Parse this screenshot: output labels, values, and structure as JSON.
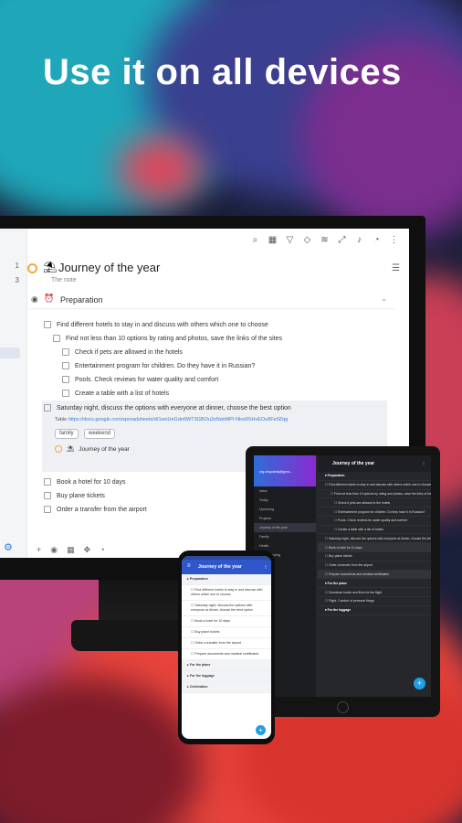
{
  "headline": "Use it on all devices",
  "desktop": {
    "sidebar_counts": [
      "1",
      "3"
    ],
    "project": {
      "title": "Journey of the year",
      "note": "The note"
    },
    "section_title": "Preparation",
    "tasks": [
      {
        "text": "Find different hotels to stay in and discuss with others which one to choose",
        "level": 0
      },
      {
        "text": "Find not less than 10 options by rating and photos, save the links of the sites",
        "level": 1
      },
      {
        "text": "Check if pets are allowed in the hotels",
        "level": 2
      },
      {
        "text": "Entertainment program for children. Do they have it in Russian?",
        "level": 2
      },
      {
        "text": "Pools. Check reviews for water quality and comfort",
        "level": 2
      },
      {
        "text": "Create a table with a list of hotels",
        "level": 2
      }
    ],
    "focus_task": {
      "text": "Saturday night, discuss the options with everyone at dinner, choose the best option",
      "link_label": "Table",
      "link_url": "https://docs.google.com/spreadsheets/d/1wnUeGdn6WT3GBOu3zNdsMPI-Nkw9SHvEOu8Fe9Zqg",
      "tags": [
        "family",
        "weekend"
      ],
      "sub_project": "Journey of the year"
    },
    "later_tasks": [
      "Book a hotel for 10 days",
      "Buy plane tickets",
      "Order a transfer from the airport"
    ]
  },
  "tablet": {
    "header_title": "Journey of the year",
    "user_email": "org.singularity@gma...",
    "sidebar": [
      "Inbox",
      "Today",
      "Upcoming",
      "Projects",
      "Journey of the year",
      "Family",
      "Health",
      "Housekeeping",
      "Beta",
      "Car",
      "Education",
      "Workout",
      "Gifts",
      "Move",
      "Books",
      "Goal",
      "Travel",
      "Blog",
      "Job"
    ],
    "rows": [
      {
        "text": "Preparation",
        "type": "sec"
      },
      {
        "text": "Find different hotels to stay in and discuss with others which one to choose",
        "type": "task"
      },
      {
        "text": "Find not less than 10 options by rating and photos, save the links of the sites",
        "type": "ind"
      },
      {
        "text": "Check if pets are allowed in the hotels",
        "type": "ind2"
      },
      {
        "text": "Entertainment program for children. Do they have it in Russian?",
        "type": "ind2"
      },
      {
        "text": "Pools. Check reviews for water quality and comfort",
        "type": "ind2"
      },
      {
        "text": "Create a table with a list of hotels",
        "type": "ind2"
      },
      {
        "text": "Saturday night, discuss the options with everyone at dinner, choose the best option",
        "type": "task"
      },
      {
        "text": "Book a hotel for 10 days",
        "type": "hl"
      },
      {
        "text": "Buy plane tickets",
        "type": "task"
      },
      {
        "text": "Order a transfer from the airport",
        "type": "task"
      },
      {
        "text": "Prepare documents and medical certificates",
        "type": "hl"
      },
      {
        "text": "For the plane",
        "type": "sec"
      },
      {
        "text": "Download books and films for the flight",
        "type": "task"
      },
      {
        "text": "Flight. Comfort of personal things",
        "type": "task"
      },
      {
        "text": "For the luggage",
        "type": "sec"
      }
    ]
  },
  "phone": {
    "header_title": "Journey of the year",
    "rows": [
      {
        "text": "Preparation",
        "type": "sec"
      },
      {
        "text": "Find different hotels to stay in and discuss with others which one to choose",
        "type": "task"
      },
      {
        "text": "Saturday night, discuss the options with everyone at dinner, choose the best option",
        "type": "task"
      },
      {
        "text": "Book a hotel for 10 days",
        "type": "task"
      },
      {
        "text": "Buy plane tickets",
        "type": "task"
      },
      {
        "text": "Order a transfer from the airport",
        "type": "task"
      },
      {
        "text": "Prepare documents and medical certificates",
        "type": "task"
      },
      {
        "text": "For the plane",
        "type": "sec"
      },
      {
        "text": "For the luggage",
        "type": "sec"
      },
      {
        "text": "Celebration",
        "type": "sec"
      }
    ]
  },
  "colors": {
    "accent": "#3a7bd5",
    "project_circle": "#f0a93b",
    "phone_header": "#2f57c9",
    "fab": "#1e9fe8"
  }
}
